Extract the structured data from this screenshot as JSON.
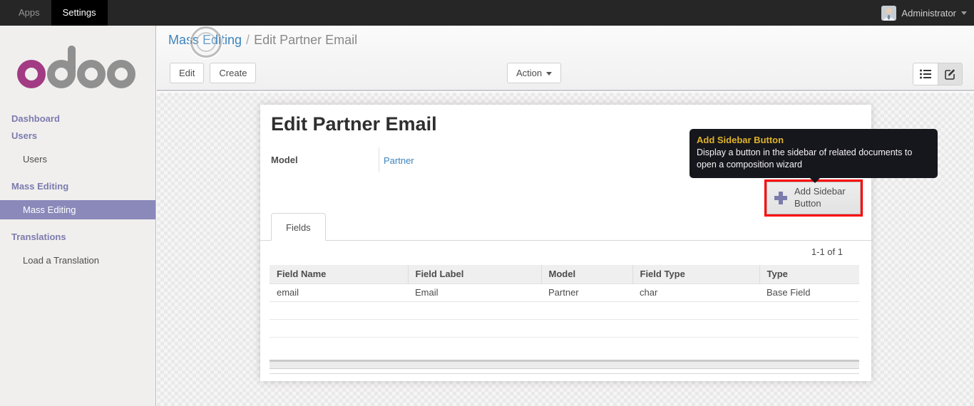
{
  "topbar": {
    "menus": [
      {
        "label": "Apps",
        "active": false
      },
      {
        "label": "Settings",
        "active": true
      }
    ],
    "user": {
      "name": "Administrator"
    }
  },
  "sidebar": {
    "logo_text": "odoo",
    "items": [
      {
        "label": "Dashboard",
        "type": "heading"
      },
      {
        "label": "Users",
        "type": "heading"
      },
      {
        "label": "Users",
        "type": "item",
        "active": false
      },
      {
        "label": "Mass Editing",
        "type": "heading"
      },
      {
        "label": "Mass Editing",
        "type": "item",
        "active": true
      },
      {
        "label": "Translations",
        "type": "heading"
      },
      {
        "label": "Load a Translation",
        "type": "item",
        "active": false
      }
    ]
  },
  "breadcrumb": {
    "parent": "Mass Editing",
    "separator": "/",
    "current": "Edit Partner Email"
  },
  "control_panel": {
    "edit_label": "Edit",
    "create_label": "Create",
    "action_label": "Action"
  },
  "form": {
    "title": "Edit Partner Email",
    "model_label": "Model",
    "model_value": "Partner",
    "sidebar_button_label": "Add Sidebar Button",
    "tooltip": {
      "title": "Add Sidebar Button",
      "body": "Display a button in the sidebar of related documents to open a composition wizard"
    },
    "tab_label": "Fields",
    "pager": "1-1 of 1",
    "table": {
      "headers": [
        "Field Name",
        "Field Label",
        "Model",
        "Field Type",
        "Type"
      ],
      "rows": [
        [
          "email",
          "Email",
          "Partner",
          "char",
          "Base Field"
        ]
      ]
    }
  },
  "colors": {
    "accent_purple": "#7c7bad",
    "selected_menu_bg": "#8a89ba",
    "link_blue": "#3c83bc",
    "tooltip_title_gold": "#dfb429",
    "highlight_red": "#ff0000",
    "logo_magenta": "#a23b83",
    "topbar_bg": "#262626"
  }
}
